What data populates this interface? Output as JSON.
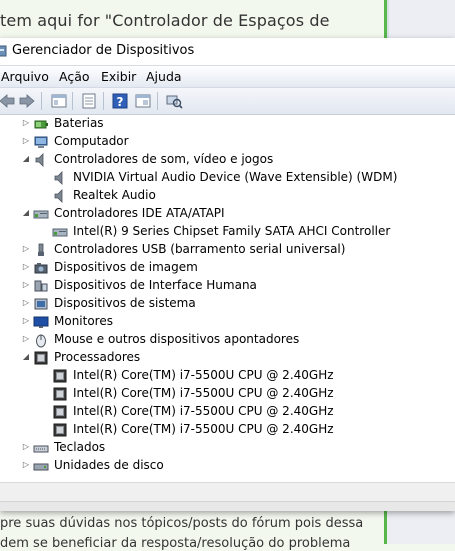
{
  "background": {
    "top_text": "tem aqui for \"Controlador de Espaços de",
    "bottom_line1": "pre suas dúvidas nos tópicos/posts do fórum pois dessa",
    "bottom_line2": "dem se beneficiar da resposta/resolução do problema"
  },
  "window": {
    "title": "Gerenciador de Dispositivos"
  },
  "menu": {
    "items": [
      "Arquivo",
      "Ação",
      "Exibir",
      "Ajuda"
    ]
  },
  "toolbar": {
    "buttons": [
      "back-arrow-icon",
      "forward-arrow-icon",
      "show-hide-tree-icon",
      "properties-icon",
      "help-icon",
      "update-driver-icon",
      "scan-hardware-icon"
    ]
  },
  "tree": {
    "items": [
      {
        "label": "Baterias",
        "level": 0,
        "expander": "collapsed",
        "icon": "battery-icon"
      },
      {
        "label": "Computador",
        "level": 0,
        "expander": "collapsed",
        "icon": "computer-icon"
      },
      {
        "label": "Controladores de som, vídeo e jogos",
        "level": 0,
        "expander": "expanded",
        "icon": "speaker-icon"
      },
      {
        "label": "NVIDIA Virtual Audio Device (Wave Extensible) (WDM)",
        "level": 1,
        "expander": "none",
        "icon": "speaker-icon"
      },
      {
        "label": "Realtek Audio",
        "level": 1,
        "expander": "none",
        "icon": "speaker-icon"
      },
      {
        "label": "Controladores IDE ATA/ATAPI",
        "level": 0,
        "expander": "expanded",
        "icon": "ide-controller-icon"
      },
      {
        "label": "Intel(R) 9 Series Chipset Family SATA AHCI Controller",
        "level": 1,
        "expander": "none",
        "icon": "ide-controller-icon"
      },
      {
        "label": "Controladores USB (barramento serial universal)",
        "level": 0,
        "expander": "collapsed",
        "icon": "usb-icon"
      },
      {
        "label": "Dispositivos de imagem",
        "level": 0,
        "expander": "collapsed",
        "icon": "camera-icon"
      },
      {
        "label": "Dispositivos de Interface Humana",
        "level": 0,
        "expander": "collapsed",
        "icon": "hid-icon"
      },
      {
        "label": "Dispositivos de sistema",
        "level": 0,
        "expander": "collapsed",
        "icon": "system-device-icon"
      },
      {
        "label": "Monitores",
        "level": 0,
        "expander": "collapsed",
        "icon": "monitor-icon"
      },
      {
        "label": "Mouse e outros dispositivos apontadores",
        "level": 0,
        "expander": "collapsed",
        "icon": "mouse-icon"
      },
      {
        "label": "Processadores",
        "level": 0,
        "expander": "expanded",
        "icon": "processor-icon"
      },
      {
        "label": "Intel(R) Core(TM) i7-5500U CPU @ 2.40GHz",
        "level": 1,
        "expander": "none",
        "icon": "processor-icon"
      },
      {
        "label": "Intel(R) Core(TM) i7-5500U CPU @ 2.40GHz",
        "level": 1,
        "expander": "none",
        "icon": "processor-icon"
      },
      {
        "label": "Intel(R) Core(TM) i7-5500U CPU @ 2.40GHz",
        "level": 1,
        "expander": "none",
        "icon": "processor-icon"
      },
      {
        "label": "Intel(R) Core(TM) i7-5500U CPU @ 2.40GHz",
        "level": 1,
        "expander": "none",
        "icon": "processor-icon"
      },
      {
        "label": "Teclados",
        "level": 0,
        "expander": "collapsed",
        "icon": "keyboard-icon"
      },
      {
        "label": "Unidades de disco",
        "level": 0,
        "expander": "collapsed",
        "icon": "disk-drive-icon"
      }
    ]
  }
}
